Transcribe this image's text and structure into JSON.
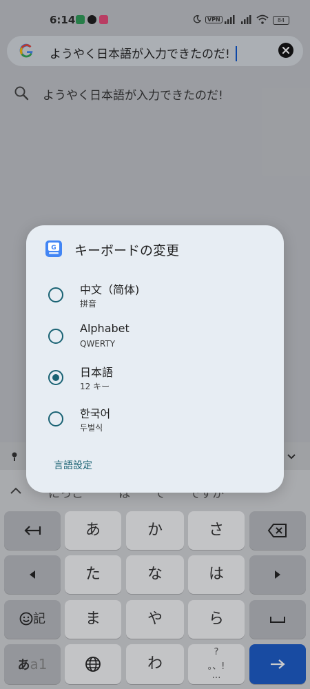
{
  "status": {
    "time": "6:14",
    "vpn": "VPN",
    "battery": "84",
    "colors": {
      "app1": "#2e9d58",
      "app2": "#1b1b1b",
      "app3": "#e84a79"
    }
  },
  "search": {
    "query": "ようやく日本語が入力できたのだ!",
    "suggestion": "ようやく日本語が入力できたのだ!"
  },
  "dialog": {
    "title": "キーボードの変更",
    "options": [
      {
        "label": "中文（简体)",
        "sub": "拼音",
        "selected": false
      },
      {
        "label": "Alphabet",
        "sub": "QWERTY",
        "selected": false
      },
      {
        "label": "日本語",
        "sub": "12 キー",
        "selected": true
      },
      {
        "label": "한국어",
        "sub": "두벌식",
        "selected": false
      }
    ],
    "footer_link": "言語設定",
    "accent": "#196273"
  },
  "keyboard": {
    "candidates": "にっこ　　　は　　て　　ですか",
    "keys": {
      "a": "あ",
      "ka": "か",
      "sa": "さ",
      "ta": "た",
      "na": "な",
      "ha": "は",
      "ma": "ま",
      "ya": "や",
      "ra": "ら",
      "wa": "わ",
      "emoji_label": "記",
      "mode_label_1": "あ",
      "mode_label_2": "a1",
      "punct_top": "?",
      "punct_mid": "。、!",
      "punct_dots": "…"
    },
    "enter_color": "#1a5bc9"
  }
}
